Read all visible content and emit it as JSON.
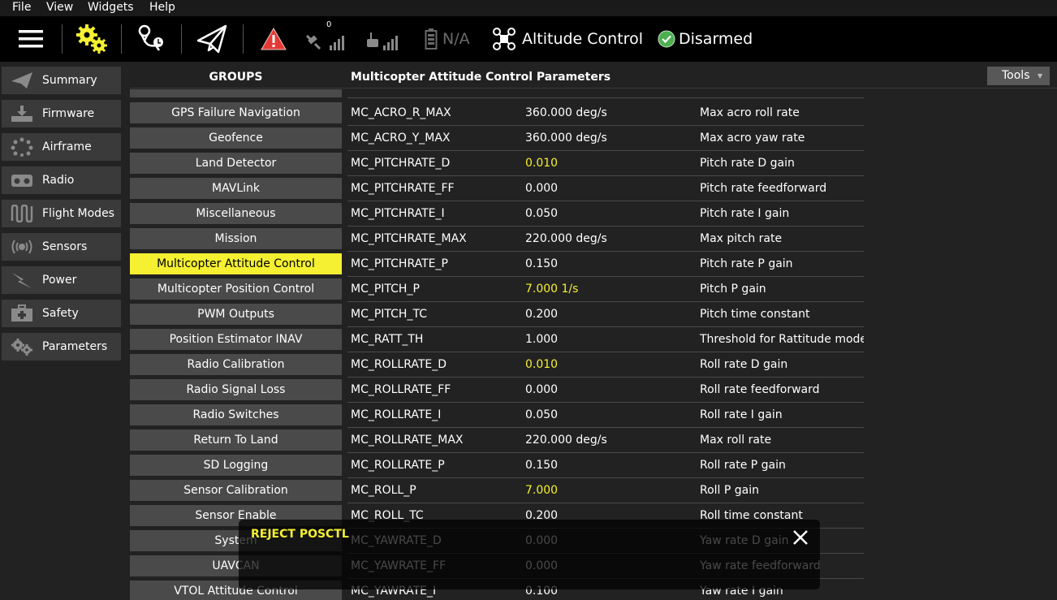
{
  "menu": [
    "File",
    "View",
    "Widgets",
    "Help"
  ],
  "toolbar": {
    "gps_count": "0",
    "battery": "N/A",
    "flight_mode": "Altitude Control",
    "arm_status": "Disarmed"
  },
  "sidebar": {
    "items": [
      {
        "label": "Summary"
      },
      {
        "label": "Firmware"
      },
      {
        "label": "Airframe"
      },
      {
        "label": "Radio"
      },
      {
        "label": "Flight Modes"
      },
      {
        "label": "Sensors"
      },
      {
        "label": "Power"
      },
      {
        "label": "Safety"
      },
      {
        "label": "Parameters"
      }
    ]
  },
  "groups": {
    "header": "GROUPS",
    "items": [
      "GPS Failure Navigation",
      "Geofence",
      "Land Detector",
      "MAVLink",
      "Miscellaneous",
      "Mission",
      "Multicopter Attitude Control",
      "Multicopter Position Control",
      "PWM Outputs",
      "Position Estimator INAV",
      "Radio Calibration",
      "Radio Signal Loss",
      "Radio Switches",
      "Return To Land",
      "SD Logging",
      "Sensor Calibration",
      "Sensor Enable",
      "System",
      "UAVCAN",
      "VTOL Attitude Control"
    ],
    "selected": "Multicopter Attitude Control"
  },
  "params": {
    "header": "Multicopter Attitude Control Parameters",
    "tools_label": "Tools",
    "rows": [
      {
        "name": "MC_ACRO_R_MAX",
        "value": "360.000 deg/s",
        "desc": "Max acro roll rate",
        "nondefault": false
      },
      {
        "name": "MC_ACRO_Y_MAX",
        "value": "360.000 deg/s",
        "desc": "Max acro yaw rate",
        "nondefault": false
      },
      {
        "name": "MC_PITCHRATE_D",
        "value": "0.010",
        "desc": "Pitch rate D gain",
        "nondefault": true
      },
      {
        "name": "MC_PITCHRATE_FF",
        "value": "0.000",
        "desc": "Pitch rate feedforward",
        "nondefault": false
      },
      {
        "name": "MC_PITCHRATE_I",
        "value": "0.050",
        "desc": "Pitch rate I gain",
        "nondefault": false
      },
      {
        "name": "MC_PITCHRATE_MAX",
        "value": "220.000 deg/s",
        "desc": "Max pitch rate",
        "nondefault": false
      },
      {
        "name": "MC_PITCHRATE_P",
        "value": "0.150",
        "desc": "Pitch rate P gain",
        "nondefault": false
      },
      {
        "name": "MC_PITCH_P",
        "value": "7.000 1/s",
        "desc": "Pitch P gain",
        "nondefault": true
      },
      {
        "name": "MC_PITCH_TC",
        "value": "0.200",
        "desc": "Pitch time constant",
        "nondefault": false
      },
      {
        "name": "MC_RATT_TH",
        "value": "1.000",
        "desc": "Threshold for Rattitude mode",
        "nondefault": false
      },
      {
        "name": "MC_ROLLRATE_D",
        "value": "0.010",
        "desc": "Roll rate D gain",
        "nondefault": true
      },
      {
        "name": "MC_ROLLRATE_FF",
        "value": "0.000",
        "desc": "Roll rate feedforward",
        "nondefault": false
      },
      {
        "name": "MC_ROLLRATE_I",
        "value": "0.050",
        "desc": "Roll rate I gain",
        "nondefault": false
      },
      {
        "name": "MC_ROLLRATE_MAX",
        "value": "220.000 deg/s",
        "desc": "Max roll rate",
        "nondefault": false
      },
      {
        "name": "MC_ROLLRATE_P",
        "value": "0.150",
        "desc": "Roll rate P gain",
        "nondefault": false
      },
      {
        "name": "MC_ROLL_P",
        "value": "7.000",
        "desc": "Roll P gain",
        "nondefault": true
      },
      {
        "name": "MC_ROLL_TC",
        "value": "0.200",
        "desc": "Roll time constant",
        "nondefault": false
      },
      {
        "name": "MC_YAWRATE_D",
        "value": "0.000",
        "desc": "Yaw rate D gain",
        "nondefault": false
      },
      {
        "name": "MC_YAWRATE_FF",
        "value": "0.000",
        "desc": "Yaw rate feedforward",
        "nondefault": false
      },
      {
        "name": "MC_YAWRATE_I",
        "value": "0.100",
        "desc": "Yaw rate I gain",
        "nondefault": false
      }
    ]
  },
  "toast": {
    "message": "REJECT POSCTL"
  },
  "colors": {
    "accent": "#f5f032",
    "ok": "#4caf50",
    "warning": "#e53935"
  },
  "icons": {
    "hamburger": "menu-icon",
    "settings": "gears-icon",
    "plan": "plan-route-icon",
    "fly": "paper-plane-icon",
    "message": "warning-triangle-icon",
    "gps": "gps-satellite-icon",
    "rc": "rc-signal-icon",
    "battery": "battery-icon",
    "mode": "drone-icon",
    "armed": "check-circle-icon"
  }
}
